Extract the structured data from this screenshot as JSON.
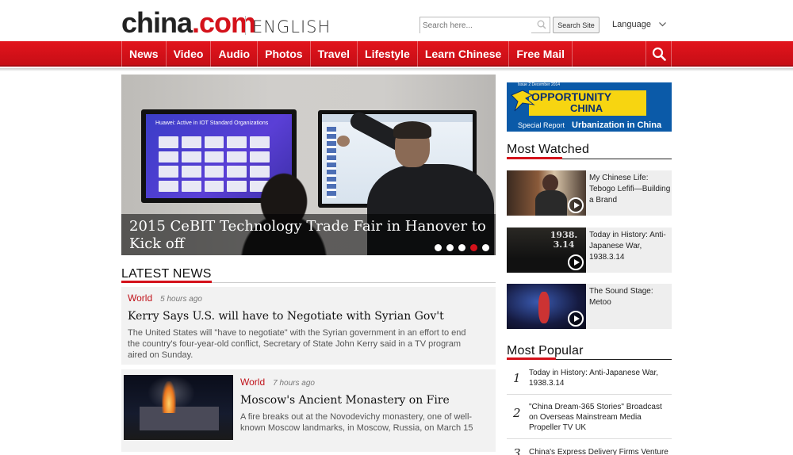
{
  "header": {
    "logo_part1": "china",
    "logo_part2": ".com",
    "edition": "ENGLISH",
    "search_placeholder": "Search here...",
    "search_button": "Search Site",
    "language_label": "Language"
  },
  "nav": {
    "items": [
      "News",
      "Video",
      "Audio",
      "Photos",
      "Travel",
      "Lifestyle",
      "Learn Chinese",
      "Free Mail"
    ]
  },
  "hero": {
    "caption": "2015 CeBIT Technology Trade Fair in Hanover to Kick off",
    "screen_text": "Huawei: Active in IOT Standard Organizations",
    "slides": 5,
    "active_slide": 4
  },
  "latest_news": {
    "heading": "LATEST NEWS",
    "items": [
      {
        "category": "World",
        "time": "5 hours ago",
        "headline": "Kerry Says U.S. will have to Negotiate with Syrian Gov't",
        "summary": "The United States will \"have to negotiate\" with the Syrian government in an effort to end the country's four-year-old conflict, Secretary of State John Kerry said in a TV program aired on Sunday."
      },
      {
        "category": "World",
        "time": "7 hours ago",
        "headline": "Moscow's Ancient Monastery on Fire",
        "summary": "A fire breaks out at the Novodevichy monastery, one of well-known Moscow landmarks, in Moscow, Russia, on March 15"
      }
    ]
  },
  "ad": {
    "issue": "Issue 2 December 2014",
    "line1": "OPPORTUNITY",
    "line2": "CHINA",
    "special": "Special Report",
    "topic": "Urbanization in China"
  },
  "most_watched": {
    "heading": "Most Watched",
    "items": [
      {
        "title": "My Chinese Life: Tebogo Lefifi—Building a Brand"
      },
      {
        "title": "Today in History: Anti-Japanese War, 1938.3.14",
        "thumb_text": "1938. 3.14"
      },
      {
        "title": "The Sound Stage: Metoo"
      }
    ]
  },
  "most_popular": {
    "heading": "Most Popular",
    "items": [
      {
        "num": "1",
        "text": "Today in History: Anti-Japanese War, 1938.3.14"
      },
      {
        "num": "2",
        "text": "\"China Dream-365 Stories\" Broadcast on Overseas Mainstream Media Propeller TV UK"
      },
      {
        "num": "3",
        "text": "China's Express Delivery Firms Venture"
      }
    ]
  },
  "colors": {
    "brand_red": "#d4121b",
    "nav_red": "#e2141c"
  }
}
